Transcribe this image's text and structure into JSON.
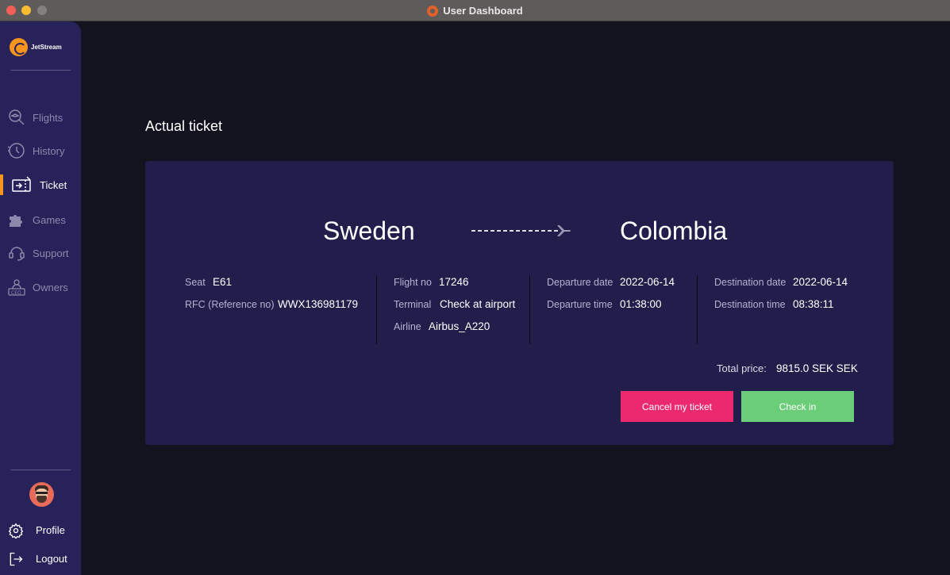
{
  "window": {
    "title": "User Dashboard"
  },
  "sidebar": {
    "logo_text": "JetStream",
    "items": [
      {
        "label": "Flights",
        "icon": "flights-search-icon"
      },
      {
        "label": "History",
        "icon": "history-clock-icon"
      },
      {
        "label": "Ticket",
        "icon": "ticket-icon",
        "active": true
      },
      {
        "label": "Games",
        "icon": "games-puzzle-icon"
      },
      {
        "label": "Support",
        "icon": "support-headset-icon"
      },
      {
        "label": "Owners",
        "icon": "owners-ceo-icon"
      }
    ],
    "profile_label": "Profile",
    "logout_label": "Logout"
  },
  "colors": {
    "accent": "#f7941d",
    "sidebar": "#27235a",
    "card": "#211e4b",
    "cancel": "#eb2a6e",
    "checkin": "#6ccd78"
  },
  "page_title": "Actual ticket",
  "ticket": {
    "from": "Sweden",
    "to": "Colombia",
    "seat_label": "Seat",
    "seat": "E61",
    "rfc_label": "RFC (Reference no)",
    "rfc": "WWX136981179",
    "flight_no_label": "Flight no",
    "flight_no": "17246",
    "terminal_label": "Terminal",
    "terminal": "Check at airport",
    "airline_label": "Airline",
    "airline": "Airbus_A220",
    "departure_date_label": "Departure date",
    "departure_date": "2022-06-14",
    "departure_time_label": "Departure time",
    "departure_time": "01:38:00",
    "destination_date_label": "Destination date",
    "destination_date": "2022-06-14",
    "destination_time_label": "Destination time",
    "destination_time": "08:38:11",
    "total_price_label": "Total price:",
    "total_price": "9815.0 SEK SEK",
    "cancel_label": "Cancel my ticket",
    "checkin_label": "Check in"
  }
}
